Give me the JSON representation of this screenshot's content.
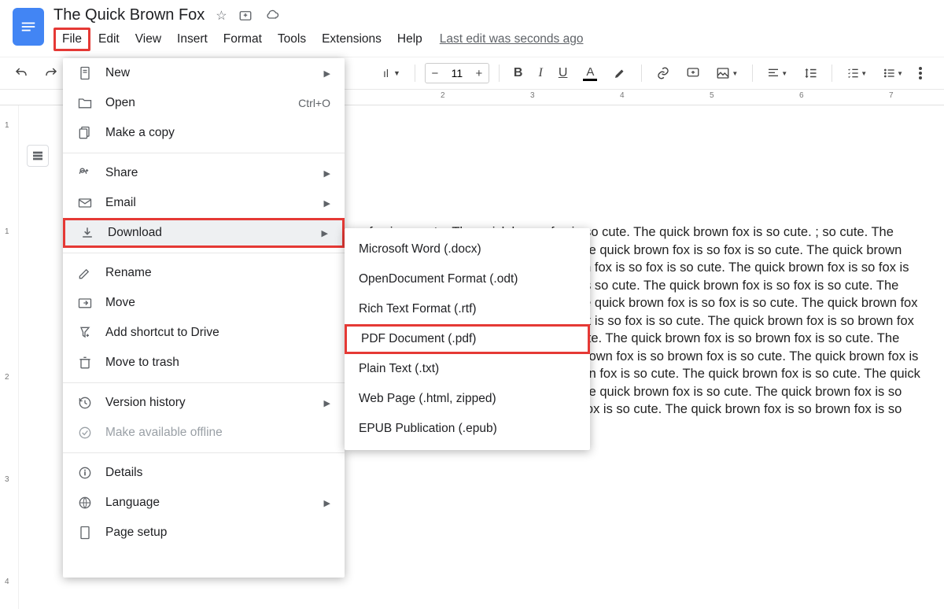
{
  "header": {
    "title": "The Quick Brown Fox",
    "last_edit": "Last edit was seconds ago"
  },
  "menubar": [
    "File",
    "Edit",
    "View",
    "Insert",
    "Format",
    "Tools",
    "Extensions",
    "Help"
  ],
  "toolbar": {
    "font_size": "11"
  },
  "ruler": {
    "horizontal": [
      "2",
      "3",
      "4",
      "5",
      "6",
      "7"
    ],
    "vertical": [
      "1",
      "1",
      "2",
      "3",
      "4"
    ]
  },
  "file_menu": {
    "items": [
      {
        "label": "New",
        "arrow": true,
        "icon": "doc"
      },
      {
        "label": "Open",
        "kb": "Ctrl+O",
        "icon": "folder"
      },
      {
        "label": "Make a copy",
        "icon": "copy"
      },
      {
        "sep": true
      },
      {
        "label": "Share",
        "arrow": true,
        "icon": "share"
      },
      {
        "label": "Email",
        "arrow": true,
        "icon": "mail"
      },
      {
        "label": "Download",
        "arrow": true,
        "icon": "download",
        "highlight": true,
        "hovered": true
      },
      {
        "sep": true
      },
      {
        "label": "Rename",
        "icon": "rename"
      },
      {
        "label": "Move",
        "icon": "move"
      },
      {
        "label": "Add shortcut to Drive",
        "icon": "shortcut"
      },
      {
        "label": "Move to trash",
        "icon": "trash"
      },
      {
        "sep": true
      },
      {
        "label": "Version history",
        "arrow": true,
        "icon": "history"
      },
      {
        "label": "Make available offline",
        "icon": "offline",
        "disabled": true
      },
      {
        "sep": true
      },
      {
        "label": "Details",
        "icon": "info"
      },
      {
        "label": "Language",
        "arrow": true,
        "icon": "globe"
      },
      {
        "label": "Page setup",
        "icon": "page"
      }
    ]
  },
  "submenu": {
    "items": [
      {
        "label": "Microsoft Word (.docx)"
      },
      {
        "label": "OpenDocument Format (.odt)"
      },
      {
        "label": "Rich Text Format (.rtf)"
      },
      {
        "label": "PDF Document (.pdf)",
        "highlight": true
      },
      {
        "label": "Plain Text (.txt)"
      },
      {
        "label": "Web Page (.html, zipped)"
      },
      {
        "label": "EPUB Publication (.epub)"
      }
    ]
  },
  "doc_body": "ı fox is so cute. The quick brown fox is so cute. The quick brown fox is so cute. ; so cute. The quick brown fox is so cute. ; so cute. The quick brown fox is so fox is so cute. The quick brown fox is so fox is so cute. The quick brown fox is so fox is so cute. The quick brown fox is so fox is so cute. The quick brown fox is so fox is so cute. The quick brown fox is so fox is so cute. The quick brown fox is so fox is so cute. The quick brown fox is so fox is so cute. The quick brown fox is so fox is so cute. The quick brown fox is so fox is so cute. The quick brown fox is so brown fox is so cute. The quick brown fox is so cute. The quick brown fox is so brown fox is so cute. The quick brown fox is so cute. The quick brown fox is so brown fox is so cute. The quick brown fox is so cute. The quick brown fox is so brown fox is so cute. The quick brown fox is so cute. The quick brown fox is so brown fox is so cute. The quick brown fox is so cute. The quick brown fox is so brown fox is so cute. The quick brown fox is so cute. The quick brown fox is so brown fox is so cute."
}
